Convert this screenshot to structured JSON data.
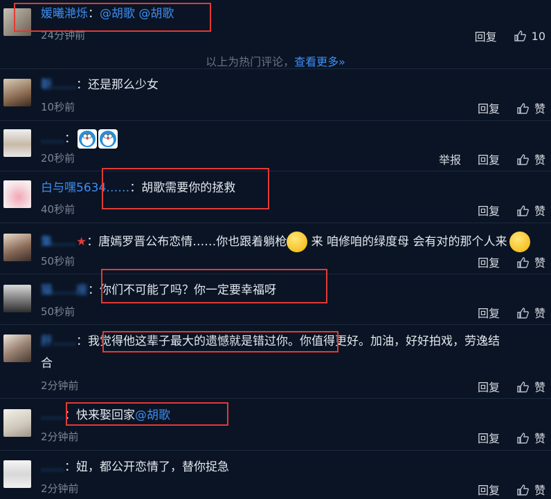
{
  "colors": {
    "background": "#0a1424",
    "link": "#3f8ef2",
    "highlight": "#e53935",
    "time": "#7d8696"
  },
  "actions": {
    "report": "举报",
    "reply": "回复",
    "like": "赞"
  },
  "banner": {
    "text": "以上为热门评论，",
    "more": "查看更多»"
  },
  "comments": [
    {
      "user": "媛曦滟烁",
      "sep": "：",
      "text": "",
      "mentions": [
        "@胡歌",
        "@胡歌"
      ],
      "time": "24分钟前",
      "likes": "10"
    },
    {
      "user": "靳……",
      "sep": "：",
      "text": "还是那么少女",
      "time": "10秒前"
    },
    {
      "user": "……",
      "sep": "：",
      "text": "",
      "time": "20秒前"
    },
    {
      "user": "白与嘿5634……",
      "sep": "：",
      "text": "胡歌需要你的拯救",
      "time": "40秒前"
    },
    {
      "user": "集……",
      "sep": "：",
      "text": "唐嫣罗晋公布恋情……你也跟着躺枪",
      "text2": "来 咱修咱的绿度母 会有对的那个人来",
      "time": "50秒前"
    },
    {
      "user": "猫……座",
      "sep": "：",
      "text": "你们不可能了吗？你一定要幸福呀",
      "time": "50秒前"
    },
    {
      "user": "肝……",
      "sep": "：",
      "text": "我觉得他这辈子最大的遗憾就是错过你。你值得更好。加油，好好拍戏，劳逸结",
      "text_cont": "合",
      "time": "2分钟前"
    },
    {
      "user": "……",
      "sep": "：",
      "text": "快来娶回家",
      "mentions": [
        "@胡歌"
      ],
      "time": "2分钟前"
    },
    {
      "user": "……",
      "sep": "：",
      "text": "妞，都公开恋情了，替你捉急",
      "time": "2分钟前"
    }
  ]
}
